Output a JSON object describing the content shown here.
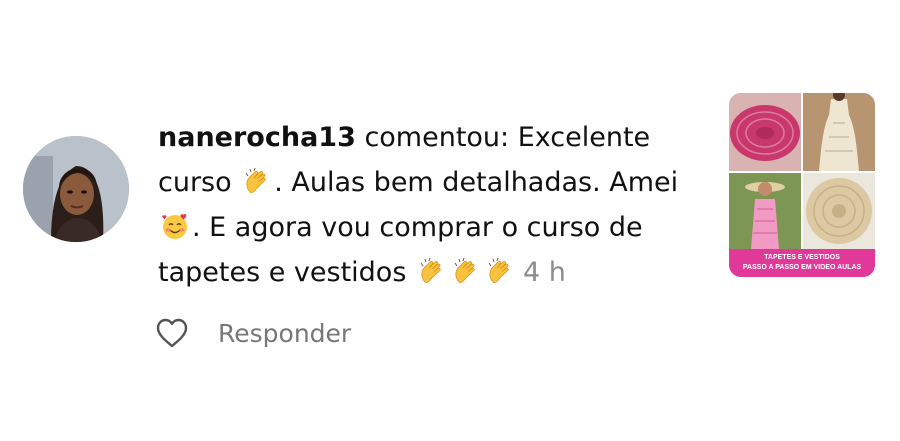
{
  "notification": {
    "username": "nanerocha13",
    "text_1": " comentou: Excelente curso ",
    "text_2": ". Aulas bem detalhadas. Amei ",
    "text_3": ". E agora vou comprar o curso de tapetes e vestidos ",
    "time": "4 h",
    "emojis": [
      "clapping-hands-emoji",
      "smiling-face-with-hearts-emoji",
      "clapping-hands-emoji",
      "clapping-hands-emoji",
      "clapping-hands-emoji"
    ]
  },
  "actions": {
    "like_icon": "heart-icon",
    "reply_label": "Responder"
  },
  "post_thumbnail": {
    "banner_line_1": "TAPETES E VESTIDOS",
    "banner_line_2": "PASSO A PASSO EM VIDEO AULAS",
    "banner_color": "#e0399a"
  },
  "colors": {
    "text": "#111111",
    "secondary_text": "#8c8c8c"
  }
}
